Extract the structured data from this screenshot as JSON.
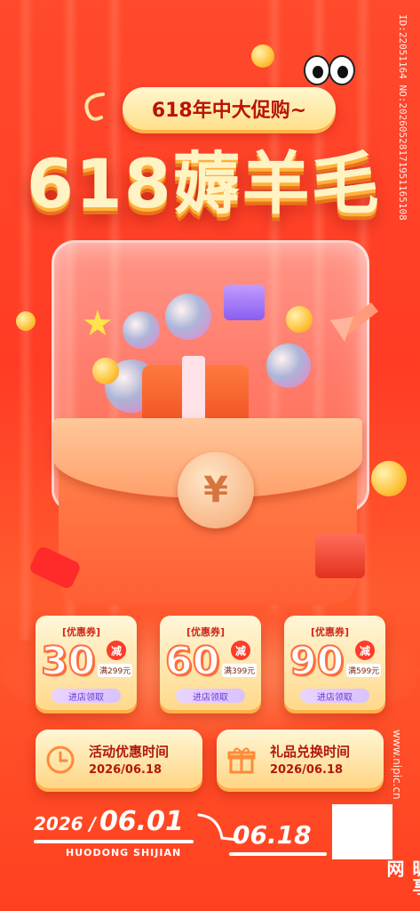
{
  "header": {
    "subtitle": "618年中大促购~",
    "title": "618薅羊毛"
  },
  "envelope": {
    "seal_symbol": "¥"
  },
  "coupons": [
    {
      "tag": "[优惠券]",
      "amount": "30",
      "badge": "减",
      "condition": "满299元",
      "action": "进店领取"
    },
    {
      "tag": "[优惠券]",
      "amount": "60",
      "badge": "减",
      "condition": "满399元",
      "action": "进店领取"
    },
    {
      "tag": "[优惠券]",
      "amount": "90",
      "badge": "减",
      "condition": "满599元",
      "action": "进店领取"
    }
  ],
  "info_cards": [
    {
      "label": "活动优惠时间",
      "date": "2026/06.18",
      "icon": "clock-icon"
    },
    {
      "label": "礼品兑换时间",
      "date": "2026/06.18",
      "icon": "gift-icon"
    }
  ],
  "timeline": {
    "start_year": "2026 /",
    "start_date": "06.01",
    "pinyin": "HUODONG SHIJIAN",
    "end_date": "06.18"
  },
  "watermark": {
    "id_text": "ID:22051164 NO:20260528171951165108",
    "url": "www.nipic.cn",
    "logo": "昵享网"
  },
  "colors": {
    "background": "#ff3b24",
    "accent_cream": "#fff3c4",
    "accent_red": "#b1180c"
  }
}
